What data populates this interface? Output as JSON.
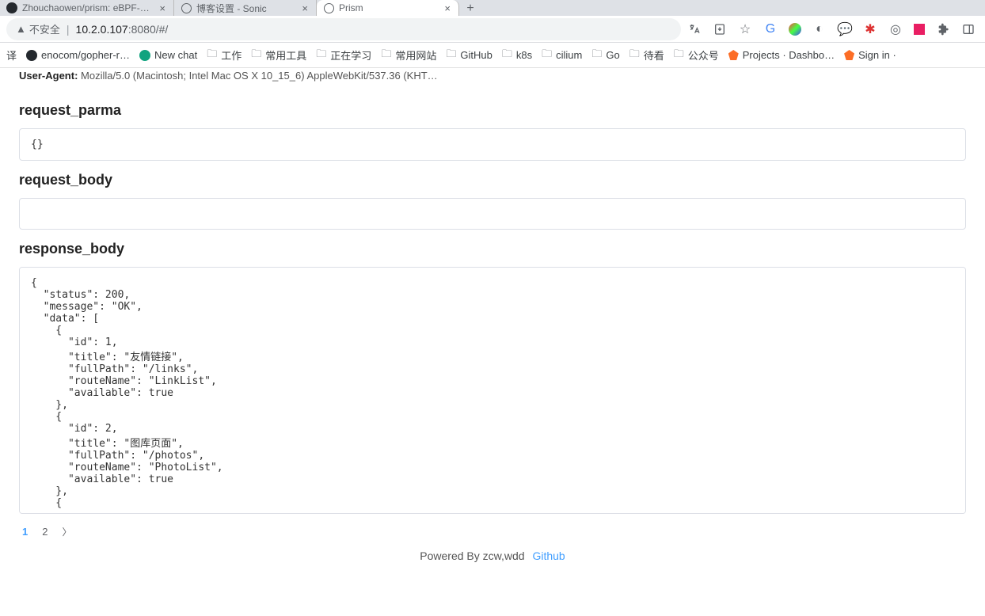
{
  "tabs": [
    {
      "title": "Zhouchaowen/prism: eBPF-ba…",
      "favicon": "github"
    },
    {
      "title": "博客设置 - Sonic",
      "favicon": "globe"
    },
    {
      "title": "Prism",
      "favicon": "globe",
      "active": true
    }
  ],
  "addr": {
    "warn_label": "不安全",
    "host": "10.2.0.107",
    "port_path": ":8080/#/"
  },
  "bookmarks": [
    {
      "icon": "text",
      "label": "译"
    },
    {
      "icon": "github",
      "label": "enocom/gopher-r…"
    },
    {
      "icon": "chat",
      "label": "New chat"
    },
    {
      "icon": "folder",
      "label": "工作"
    },
    {
      "icon": "folder",
      "label": "常用工具"
    },
    {
      "icon": "folder",
      "label": "正在学习"
    },
    {
      "icon": "folder",
      "label": "常用网站"
    },
    {
      "icon": "folder",
      "label": "GitHub"
    },
    {
      "icon": "folder",
      "label": "k8s"
    },
    {
      "icon": "folder",
      "label": "cilium"
    },
    {
      "icon": "folder",
      "label": "Go"
    },
    {
      "icon": "folder",
      "label": "待看"
    },
    {
      "icon": "folder",
      "label": "公众号"
    },
    {
      "icon": "gitlab",
      "label": "Projects · Dashbo…"
    },
    {
      "icon": "gitlab",
      "label": "Sign in ·"
    }
  ],
  "ua": {
    "label": "User-Agent:",
    "value": "Mozilla/5.0 (Macintosh; Intel Mac OS X 10_15_6) AppleWebKit/537.36 (KHT…"
  },
  "sections": {
    "request_parma": {
      "title": "request_parma",
      "content": "{}"
    },
    "request_body": {
      "title": "request_body",
      "content": ""
    },
    "response_body": {
      "title": "response_body",
      "content": "{\n  \"status\": 200,\n  \"message\": \"OK\",\n  \"data\": [\n    {\n      \"id\": 1,\n      \"title\": \"友情链接\",\n      \"fullPath\": \"/links\",\n      \"routeName\": \"LinkList\",\n      \"available\": true\n    },\n    {\n      \"id\": 2,\n      \"title\": \"图库页面\",\n      \"fullPath\": \"/photos\",\n      \"routeName\": \"PhotoList\",\n      \"available\": true\n    },\n    {"
    }
  },
  "pagination": {
    "pages": [
      "1",
      "2"
    ],
    "active": 0
  },
  "footer": {
    "text": "Powered By zcw,wdd",
    "link_label": "Github"
  }
}
